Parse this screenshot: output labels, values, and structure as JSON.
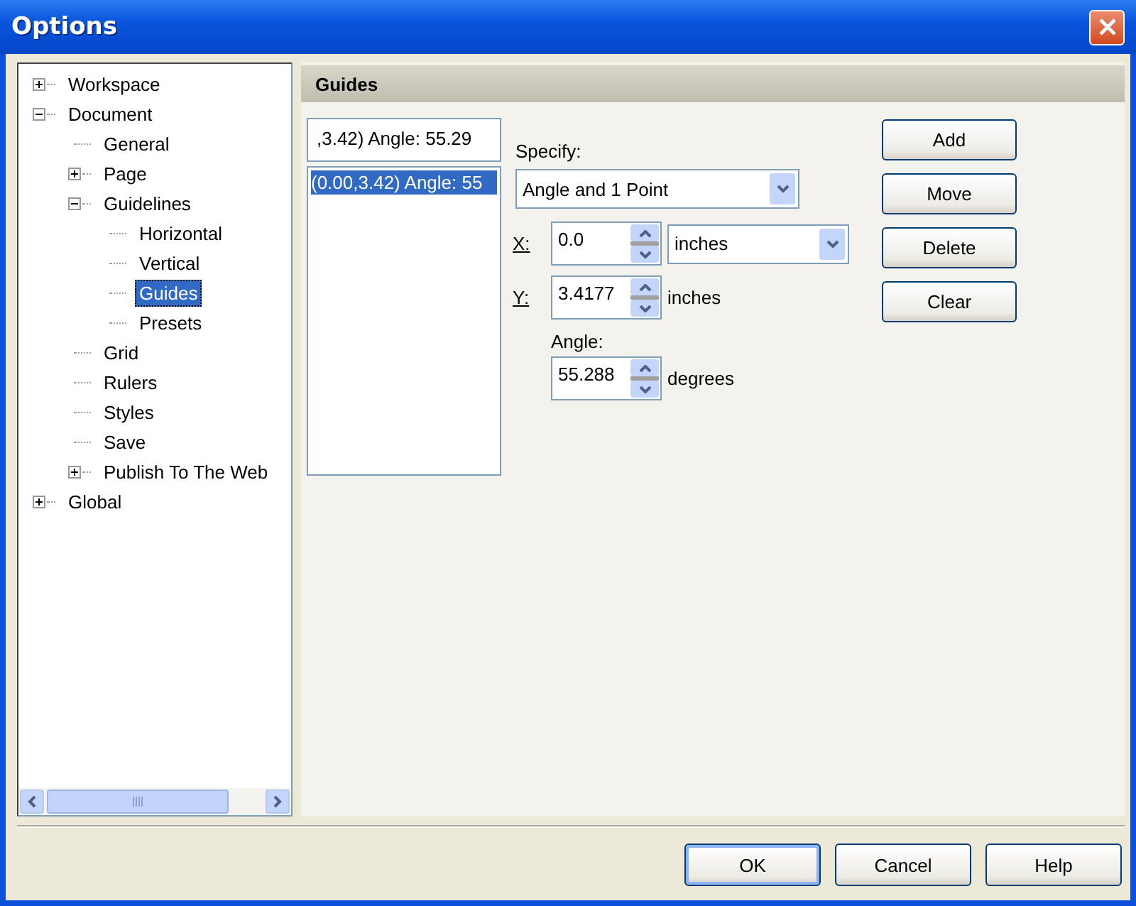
{
  "window": {
    "title": "Options"
  },
  "tree": [
    {
      "label": "Workspace",
      "expanded": false,
      "selected": false
    },
    {
      "label": "Document",
      "expanded": true,
      "selected": false,
      "children": [
        {
          "label": "General",
          "selected": false
        },
        {
          "label": "Page",
          "expanded": false,
          "selected": false
        },
        {
          "label": "Guidelines",
          "expanded": true,
          "selected": false,
          "children": [
            {
              "label": "Horizontal",
              "selected": false
            },
            {
              "label": "Vertical",
              "selected": false
            },
            {
              "label": "Guides",
              "selected": true
            },
            {
              "label": "Presets",
              "selected": false
            }
          ]
        },
        {
          "label": "Grid",
          "selected": false
        },
        {
          "label": "Rulers",
          "selected": false
        },
        {
          "label": "Styles",
          "selected": false
        },
        {
          "label": "Save",
          "selected": false
        },
        {
          "label": "Publish To The Web",
          "expanded": false,
          "selected": false
        }
      ]
    },
    {
      "label": "Global",
      "expanded": false,
      "selected": false
    }
  ],
  "panel": {
    "title": "Guides",
    "guide_entry": ",3.42) Angle: 55.29",
    "guides": [
      {
        "label": "(0.00,3.42) Angle: 55",
        "selected": true
      }
    ],
    "specify": {
      "label": "Specify:",
      "value": "Angle and 1 Point"
    },
    "x": {
      "label": "X:",
      "value": "0.0",
      "unit": "inches"
    },
    "y": {
      "label": "Y:",
      "value": "3.4177",
      "unit": "inches"
    },
    "angle": {
      "label": "Angle:",
      "value": "55.288",
      "unit": "degrees"
    },
    "actions": [
      "Add",
      "Move",
      "Delete",
      "Clear"
    ]
  },
  "buttons": [
    {
      "label": "OK",
      "default": true
    },
    {
      "label": "Cancel",
      "default": false
    },
    {
      "label": "Help",
      "default": false
    }
  ]
}
